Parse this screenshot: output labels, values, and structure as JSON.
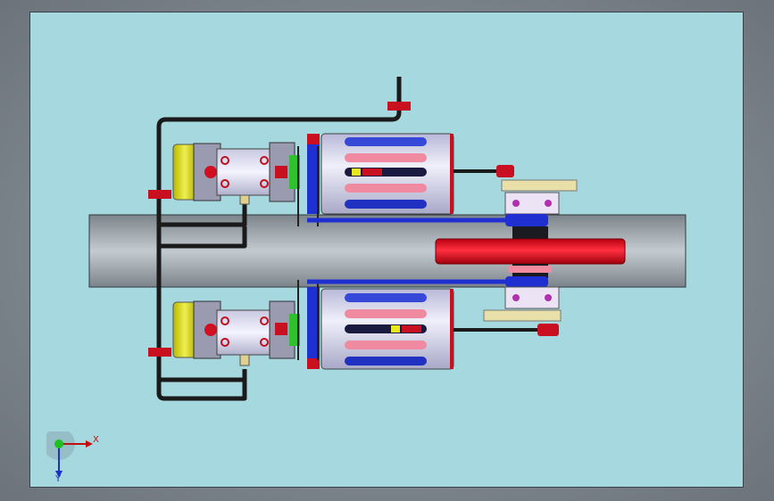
{
  "window": {
    "background_color": "#a6d8e0"
  },
  "model": {
    "shaft_color": "#8f979e",
    "flywheel_color": "#e01020",
    "cylinder_color": "#d9d9f2",
    "piping_color": "#1a1a1a",
    "accent_blue": "#2030d0",
    "accent_red": "#c81020",
    "accent_yellow": "#d8d820",
    "accent_green": "#30c030"
  },
  "triad": {
    "x_label": "X",
    "y_label": "Y",
    "x_icon": "x-axis-arrow-icon",
    "y_icon": "y-axis-arrow-icon",
    "origin_icon": "origin-sphere-icon"
  }
}
